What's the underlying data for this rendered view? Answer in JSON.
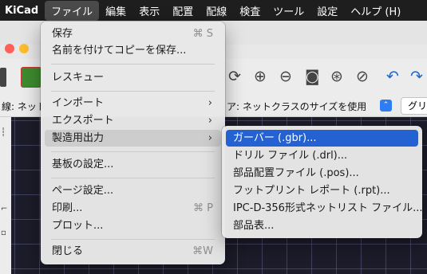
{
  "menubar": {
    "app": "KiCad",
    "items": [
      "ファイル",
      "編集",
      "表示",
      "配置",
      "配線",
      "検査",
      "ツール",
      "設定",
      "ヘルプ (H)"
    ]
  },
  "traffic_colors": [
    "#ff5f57",
    "#febc2e",
    "#28c840"
  ],
  "options_bar": {
    "track_label": "線: ネット",
    "via_label": "ア: ネットクラスのサイズを使用",
    "grid_label": "グリ"
  },
  "file_menu": {
    "items": [
      {
        "label": "保存",
        "shortcut": "⌘ S"
      },
      {
        "label": "名前を付けてコピーを保存..."
      },
      {
        "label": "レスキュー"
      },
      {
        "label": "インポート",
        "arrow": "›"
      },
      {
        "label": "エクスポート",
        "arrow": "›"
      },
      {
        "label": "製造用出力",
        "arrow": "›"
      },
      {
        "label": "基板の設定..."
      },
      {
        "label": "ページ設定..."
      },
      {
        "label": "印刷...",
        "shortcut": "⌘ P"
      },
      {
        "label": "プロット..."
      },
      {
        "label": "閉じる",
        "shortcut": "⌘W"
      }
    ]
  },
  "fab_submenu": {
    "items": [
      "ガーバー (.gbr)...",
      "ドリル ファイル (.drl)...",
      "部品配置ファイル (.pos)...",
      "フットプリント レポート (.rpt)...",
      "IPC-D-356形式ネットリスト ファイル...",
      "部品表..."
    ]
  },
  "toolbar_icons": [
    "page-icon",
    "board-setup-icon",
    "refresh-icon",
    "zoom-in-icon",
    "zoom-out-icon",
    "zoom-fit-icon",
    "zoom-objects-icon",
    "zoom-selection-icon",
    "flip-icon",
    "undo-icon",
    "redo-icon"
  ]
}
